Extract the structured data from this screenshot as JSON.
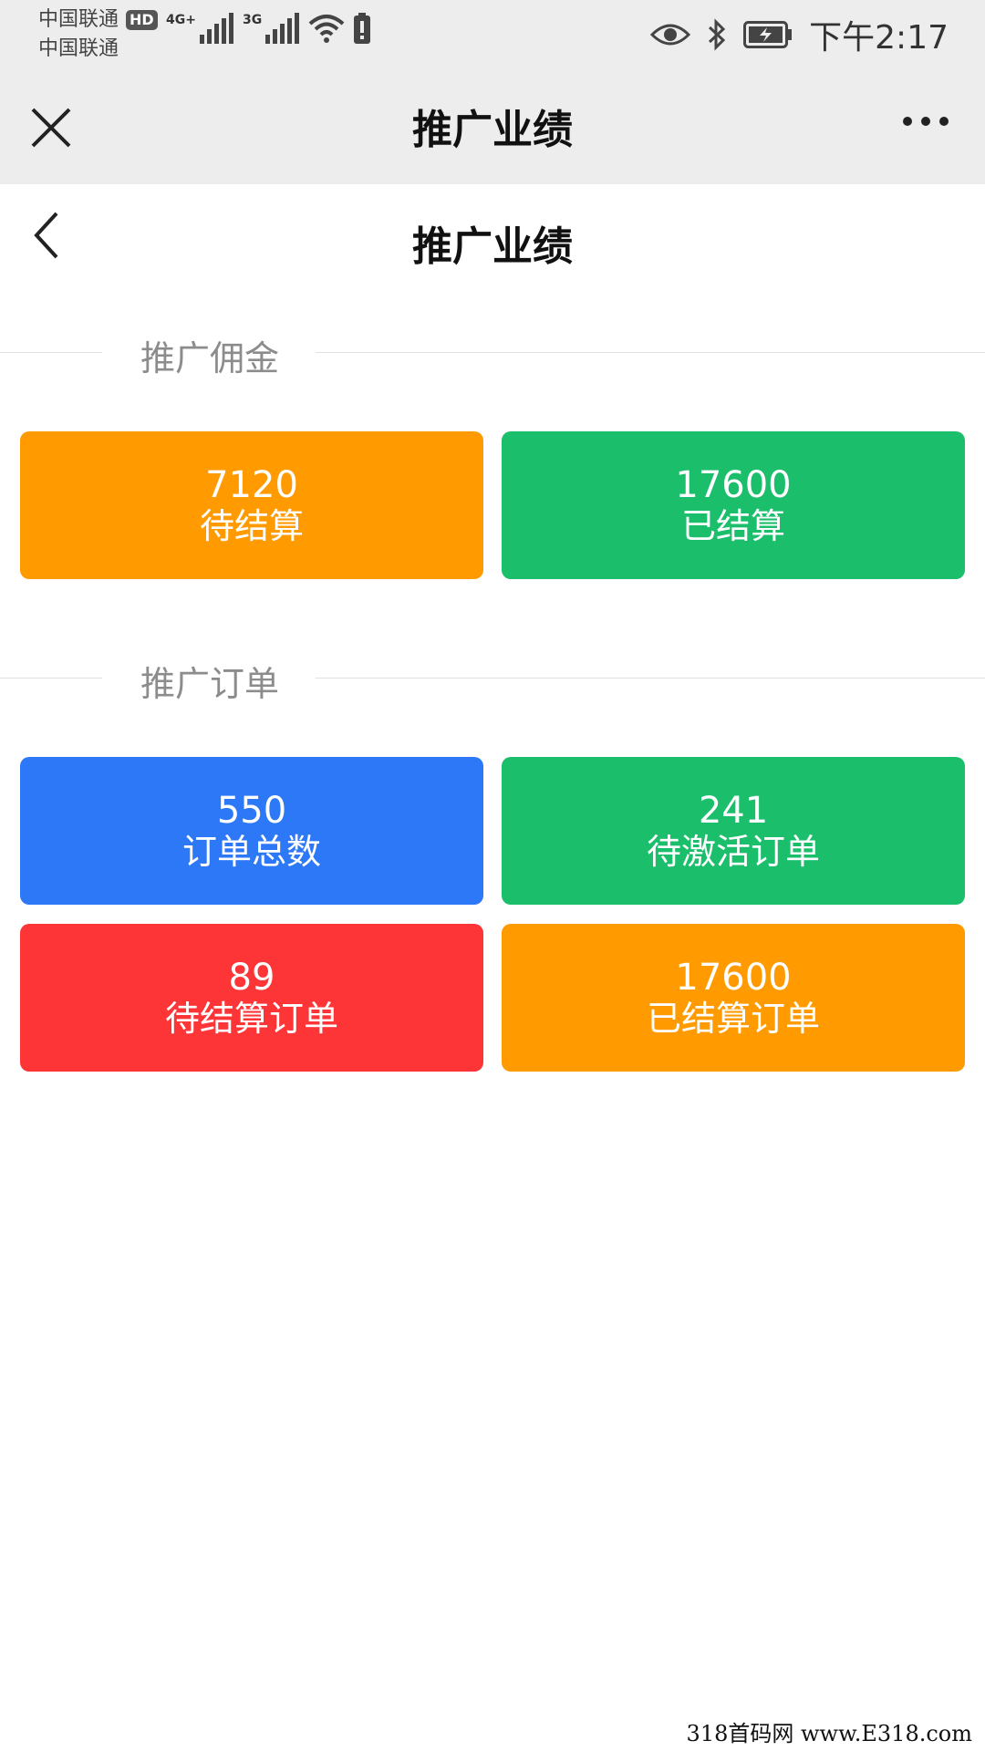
{
  "status_bar": {
    "carrier1": "中国联通",
    "carrier2": "中国联通",
    "hd": "HD",
    "net1": "4G+",
    "net2": "3G",
    "time": "下午2:17"
  },
  "wx_titlebar": {
    "title": "推广业绩"
  },
  "page_header": {
    "title": "推广业绩"
  },
  "sections": [
    {
      "title": "推广佣金",
      "cards": [
        {
          "value": "7120",
          "label": "待结算",
          "color": "#ff9a01"
        },
        {
          "value": "17600",
          "label": "已结算",
          "color": "#1bbe6a"
        }
      ]
    },
    {
      "title": "推广订单",
      "cards": [
        {
          "value": "550",
          "label": "订单总数",
          "color": "#2d78f7"
        },
        {
          "value": "241",
          "label": "待激活订单",
          "color": "#1bbe6a"
        },
        {
          "value": "89",
          "label": "待结算订单",
          "color": "#fd3537"
        },
        {
          "value": "17600",
          "label": "已结算订单",
          "color": "#ff9a01"
        }
      ]
    }
  ],
  "watermark": "318首码网 www.E318.com"
}
